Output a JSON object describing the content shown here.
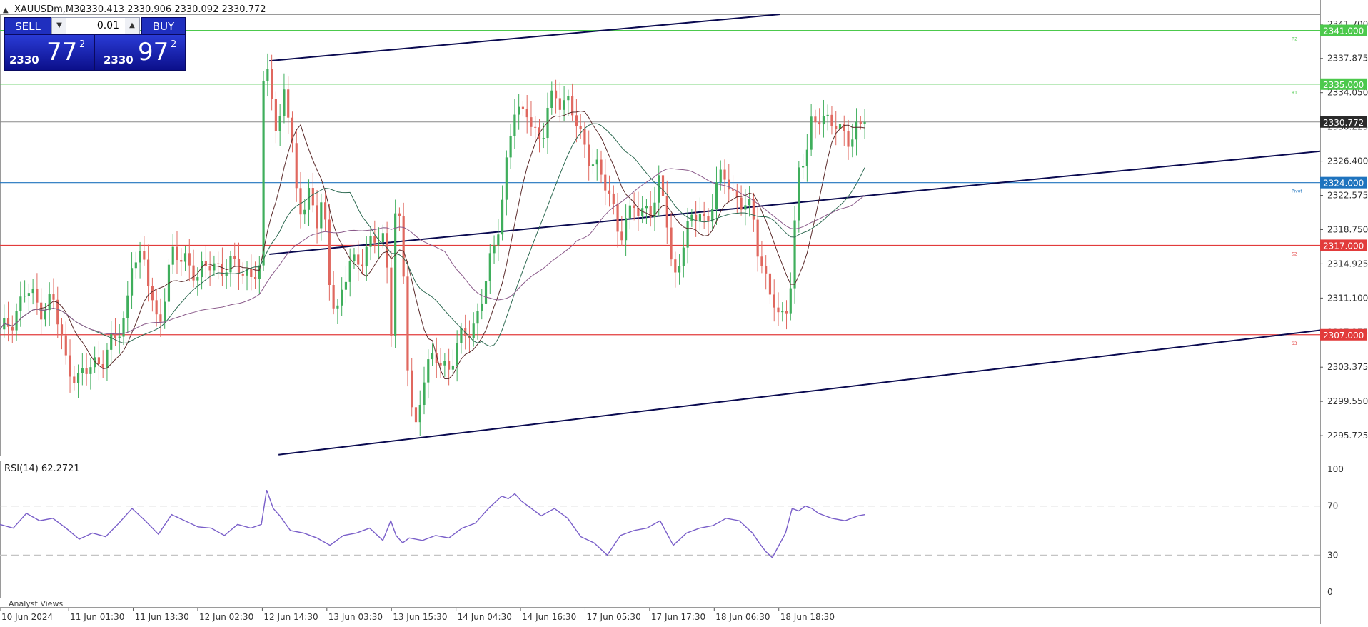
{
  "header": {
    "symbol": "XAUUSDm,M30",
    "ohlc": "2330.413 2330.906 2330.092 2330.772"
  },
  "trade_panel": {
    "sell_label": "SELL",
    "buy_label": "BUY",
    "lot_value": "0.01",
    "sell_big": "2330",
    "sell_pips": "77",
    "sell_sup": "2",
    "buy_big": "2330",
    "buy_pips": "97",
    "buy_sup": "2"
  },
  "chart_data": {
    "type": "candlestick",
    "symbol": "XAUUSDm",
    "timeframe": "M30",
    "y_axis": {
      "range": [
        2293.5,
        2342.8
      ],
      "ticks": [
        "2341.700",
        "2337.875",
        "2334.050",
        "2330.225",
        "2326.400",
        "2322.575",
        "2318.750",
        "2314.925",
        "2311.100",
        "2307.275",
        "2303.375",
        "2299.550",
        "2295.725"
      ]
    },
    "x_axis": {
      "ticks": [
        "10 Jun 2024",
        "11 Jun 01:30",
        "11 Jun 13:30",
        "12 Jun 02:30",
        "12 Jun 14:30",
        "13 Jun 03:30",
        "13 Jun 15:30",
        "14 Jun 04:30",
        "14 Jun 16:30",
        "17 Jun 05:30",
        "17 Jun 17:30",
        "18 Jun 06:30",
        "18 Jun 18:30"
      ]
    },
    "current_price": {
      "value": 2330.772,
      "label": "2330.772",
      "color": "#2b2b2b"
    },
    "pivot_levels": [
      {
        "name": "R2",
        "value": 2341.0,
        "label": "2341.000",
        "color": "#4cc94c"
      },
      {
        "name": "R1",
        "value": 2335.0,
        "label": "2335.000",
        "color": "#4cc94c"
      },
      {
        "name": "Pivot",
        "value": 2324.0,
        "label": "2324.000",
        "color": "#1e73be"
      },
      {
        "name": "S2",
        "value": 2317.0,
        "label": "2317.000",
        "color": "#e23b3b"
      },
      {
        "name": "S3",
        "value": 2307.0,
        "label": "2307.000",
        "color": "#e23b3b"
      }
    ],
    "channel_lines": [
      {
        "name": "upper",
        "x1": 0.204,
        "y1": 2337.6,
        "x2": 0.591,
        "y2": 2342.8
      },
      {
        "name": "middle",
        "x1": 0.204,
        "y1": 2316.0,
        "x2": 1.0,
        "y2": 2327.5
      },
      {
        "name": "lower",
        "x1": 0.211,
        "y1": 2293.6,
        "x2": 1.0,
        "y2": 2307.5
      }
    ],
    "close_path": [
      [
        0.0,
        2307.0
      ],
      [
        0.01,
        2309.0
      ],
      [
        0.02,
        2312.0
      ],
      [
        0.03,
        2310.0
      ],
      [
        0.04,
        2311.0
      ],
      [
        0.05,
        2304.0
      ],
      [
        0.06,
        2302.0
      ],
      [
        0.07,
        2303.5
      ],
      [
        0.08,
        2305.0
      ],
      [
        0.09,
        2307.0
      ],
      [
        0.095,
        2309.0
      ],
      [
        0.1,
        2316.0
      ],
      [
        0.11,
        2314.5
      ],
      [
        0.12,
        2308.0
      ],
      [
        0.13,
        2315.5
      ],
      [
        0.14,
        2316.0
      ],
      [
        0.15,
        2313.0
      ],
      [
        0.16,
        2315.5
      ],
      [
        0.17,
        2314.0
      ],
      [
        0.18,
        2315.0
      ],
      [
        0.19,
        2313.5
      ],
      [
        0.198,
        2314.0
      ],
      [
        0.2,
        2339.0
      ],
      [
        0.205,
        2336.0
      ],
      [
        0.21,
        2328.0
      ],
      [
        0.215,
        2335.0
      ],
      [
        0.22,
        2329.0
      ],
      [
        0.225,
        2323.0
      ],
      [
        0.23,
        2321.0
      ],
      [
        0.235,
        2323.0
      ],
      [
        0.24,
        2319.0
      ],
      [
        0.245,
        2322.0
      ],
      [
        0.25,
        2313.0
      ],
      [
        0.255,
        2309.0
      ],
      [
        0.265,
        2315.0
      ],
      [
        0.275,
        2316.0
      ],
      [
        0.285,
        2317.5
      ],
      [
        0.292,
        2318.0
      ],
      [
        0.296,
        2307.0
      ],
      [
        0.3,
        2323.0
      ],
      [
        0.305,
        2315.0
      ],
      [
        0.31,
        2300.0
      ],
      [
        0.315,
        2297.0
      ],
      [
        0.32,
        2302.0
      ],
      [
        0.33,
        2304.5
      ],
      [
        0.34,
        2303.5
      ],
      [
        0.35,
        2306.5
      ],
      [
        0.36,
        2308.5
      ],
      [
        0.37,
        2314.0
      ],
      [
        0.375,
        2317.0
      ],
      [
        0.38,
        2322.0
      ],
      [
        0.385,
        2328.0
      ],
      [
        0.39,
        2332.0
      ],
      [
        0.395,
        2331.0
      ],
      [
        0.4,
        2332.5
      ],
      [
        0.405,
        2330.0
      ],
      [
        0.41,
        2328.0
      ],
      [
        0.415,
        2332.0
      ],
      [
        0.42,
        2334.0
      ],
      [
        0.425,
        2333.5
      ],
      [
        0.43,
        2333.0
      ],
      [
        0.435,
        2331.0
      ],
      [
        0.44,
        2329.0
      ],
      [
        0.445,
        2327.5
      ],
      [
        0.45,
        2326.5
      ],
      [
        0.455,
        2324.5
      ],
      [
        0.46,
        2323.0
      ],
      [
        0.465,
        2321.0
      ],
      [
        0.47,
        2318.5
      ],
      [
        0.475,
        2319.5
      ],
      [
        0.48,
        2321.5
      ],
      [
        0.485,
        2320.0
      ],
      [
        0.49,
        2322.0
      ],
      [
        0.495,
        2321.0
      ],
      [
        0.5,
        2324.0
      ],
      [
        0.505,
        2320.0
      ],
      [
        0.51,
        2313.0
      ],
      [
        0.515,
        2316.0
      ],
      [
        0.52,
        2318.0
      ],
      [
        0.525,
        2320.0
      ],
      [
        0.53,
        2321.0
      ],
      [
        0.535,
        2319.5
      ],
      [
        0.54,
        2322.0
      ],
      [
        0.545,
        2324.0
      ],
      [
        0.55,
        2325.0
      ],
      [
        0.555,
        2323.0
      ],
      [
        0.56,
        2322.0
      ],
      [
        0.565,
        2321.0
      ],
      [
        0.57,
        2320.5
      ],
      [
        0.575,
        2316.0
      ],
      [
        0.58,
        2313.5
      ],
      [
        0.585,
        2311.0
      ],
      [
        0.59,
        2308.0
      ],
      [
        0.595,
        2310.0
      ],
      [
        0.6,
        2314.0
      ],
      [
        0.603,
        2322.0
      ],
      [
        0.606,
        2327.0
      ],
      [
        0.61,
        2325.5
      ],
      [
        0.615,
        2331.0
      ],
      [
        0.62,
        2332.0
      ],
      [
        0.625,
        2331.0
      ],
      [
        0.63,
        2330.5
      ],
      [
        0.635,
        2329.5
      ],
      [
        0.64,
        2330.0
      ],
      [
        0.645,
        2329.0
      ],
      [
        0.65,
        2330.0
      ],
      [
        0.655,
        2330.772
      ]
    ],
    "indicators": {
      "rsi": {
        "name": "RSI(14)",
        "value": "62.2721",
        "label": "RSI(14) 62.2721",
        "range": [
          0,
          100
        ],
        "levels": [
          30,
          70
        ],
        "tick_labels": [
          "100",
          "70",
          "30",
          "0"
        ],
        "color": "#7a5fc9",
        "values_path": [
          [
            0.0,
            55
          ],
          [
            0.01,
            52
          ],
          [
            0.02,
            64
          ],
          [
            0.03,
            58
          ],
          [
            0.04,
            60
          ],
          [
            0.05,
            52
          ],
          [
            0.06,
            43
          ],
          [
            0.07,
            48
          ],
          [
            0.08,
            45
          ],
          [
            0.09,
            56
          ],
          [
            0.1,
            68
          ],
          [
            0.11,
            58
          ],
          [
            0.12,
            47
          ],
          [
            0.13,
            63
          ],
          [
            0.14,
            58
          ],
          [
            0.15,
            53
          ],
          [
            0.16,
            52
          ],
          [
            0.17,
            46
          ],
          [
            0.18,
            55
          ],
          [
            0.19,
            52
          ],
          [
            0.198,
            55
          ],
          [
            0.202,
            83
          ],
          [
            0.207,
            68
          ],
          [
            0.212,
            62
          ],
          [
            0.22,
            50
          ],
          [
            0.23,
            48
          ],
          [
            0.24,
            44
          ],
          [
            0.25,
            38
          ],
          [
            0.26,
            46
          ],
          [
            0.27,
            48
          ],
          [
            0.28,
            52
          ],
          [
            0.29,
            42
          ],
          [
            0.296,
            58
          ],
          [
            0.3,
            46
          ],
          [
            0.305,
            40
          ],
          [
            0.31,
            44
          ],
          [
            0.32,
            42
          ],
          [
            0.33,
            46
          ],
          [
            0.34,
            44
          ],
          [
            0.35,
            52
          ],
          [
            0.36,
            56
          ],
          [
            0.37,
            68
          ],
          [
            0.38,
            78
          ],
          [
            0.385,
            76
          ],
          [
            0.39,
            80
          ],
          [
            0.395,
            74
          ],
          [
            0.4,
            70
          ],
          [
            0.41,
            62
          ],
          [
            0.42,
            68
          ],
          [
            0.43,
            60
          ],
          [
            0.44,
            45
          ],
          [
            0.45,
            40
          ],
          [
            0.46,
            30
          ],
          [
            0.47,
            46
          ],
          [
            0.48,
            50
          ],
          [
            0.49,
            52
          ],
          [
            0.5,
            58
          ],
          [
            0.51,
            38
          ],
          [
            0.52,
            48
          ],
          [
            0.53,
            52
          ],
          [
            0.54,
            54
          ],
          [
            0.55,
            60
          ],
          [
            0.56,
            58
          ],
          [
            0.57,
            48
          ],
          [
            0.575,
            40
          ],
          [
            0.58,
            33
          ],
          [
            0.585,
            28
          ],
          [
            0.59,
            38
          ],
          [
            0.595,
            48
          ],
          [
            0.6,
            68
          ],
          [
            0.605,
            66
          ],
          [
            0.61,
            70
          ],
          [
            0.615,
            68
          ],
          [
            0.62,
            64
          ],
          [
            0.63,
            60
          ],
          [
            0.64,
            58
          ],
          [
            0.65,
            62
          ],
          [
            0.655,
            63
          ]
        ]
      }
    },
    "bottom_label": "Analyst Views"
  }
}
